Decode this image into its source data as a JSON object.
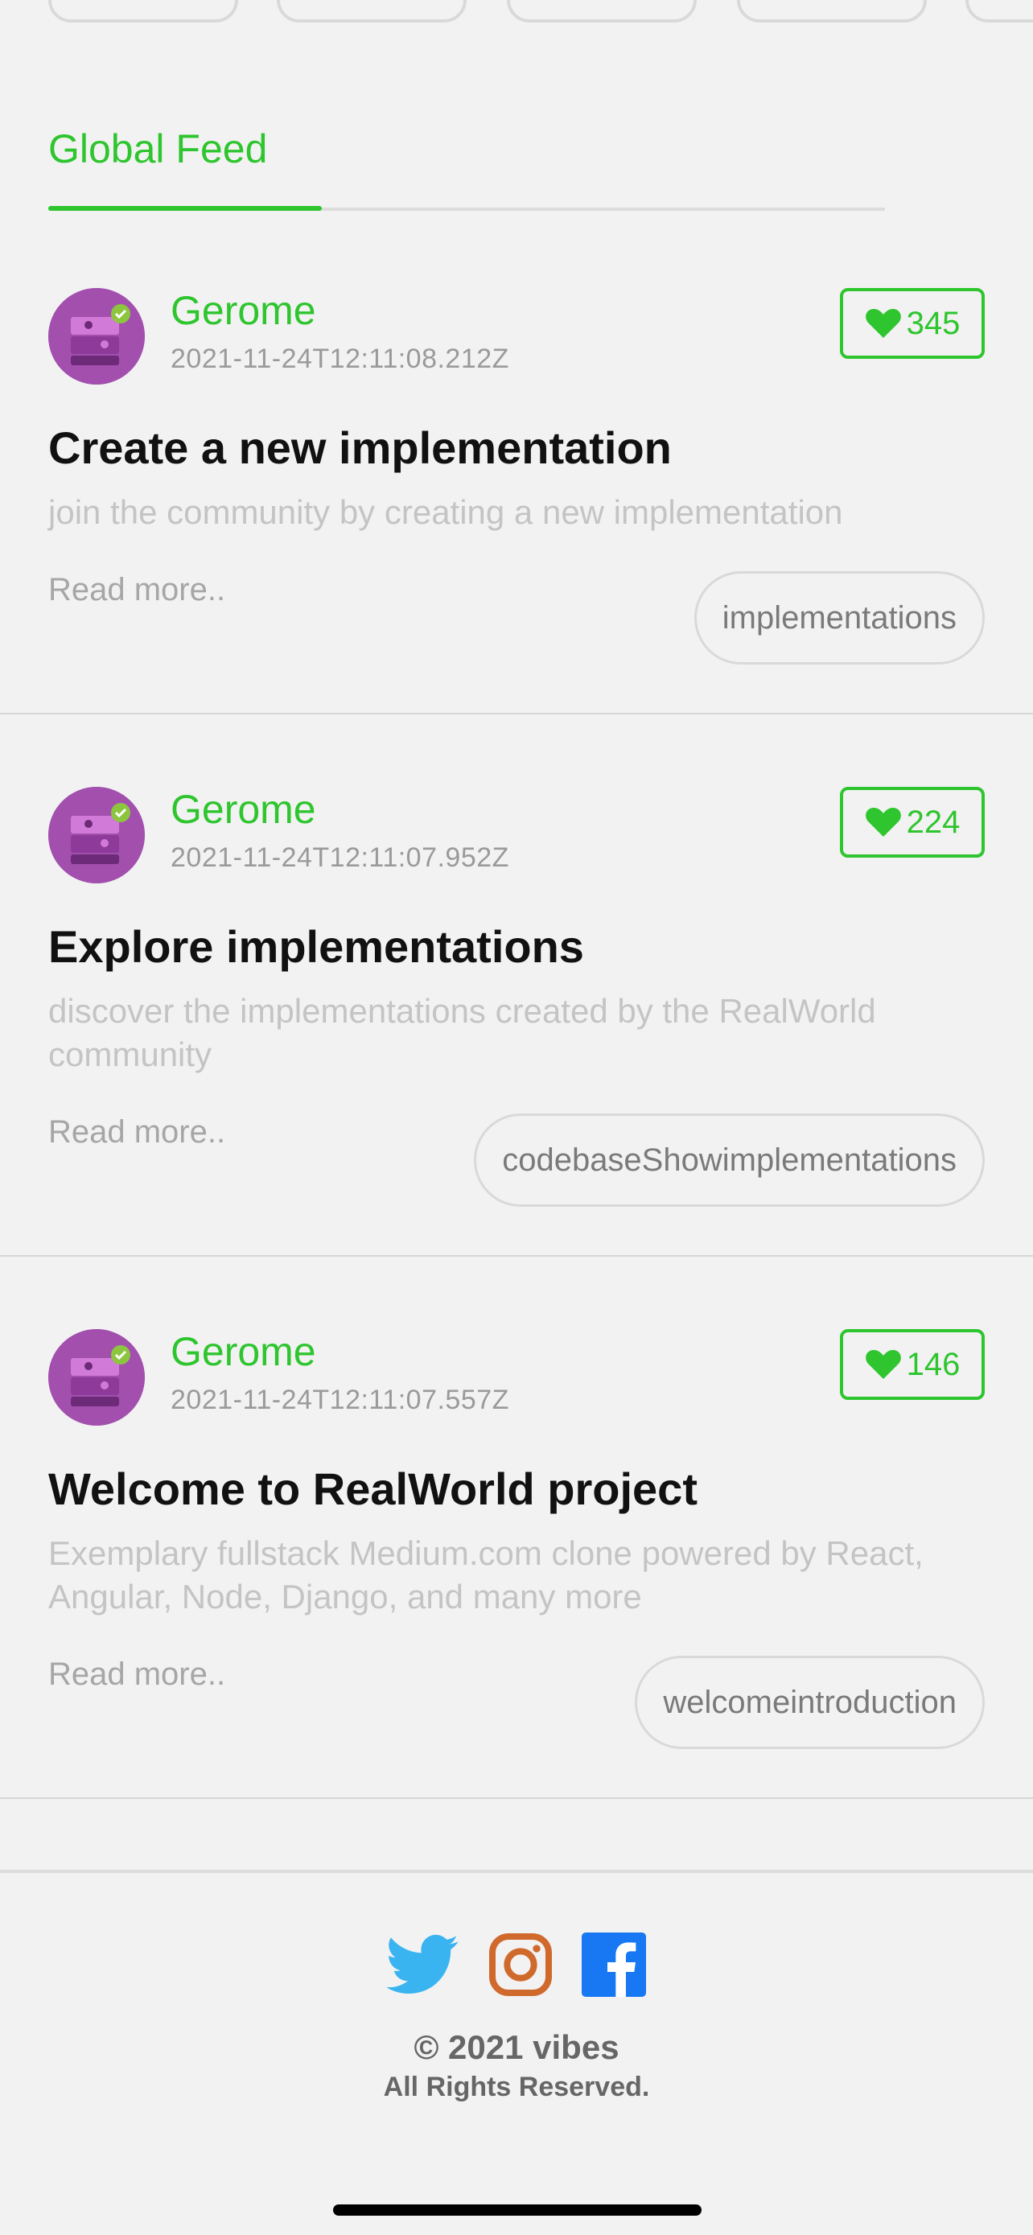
{
  "feed": {
    "tab_label": "Global Feed"
  },
  "articles": [
    {
      "author": "Gerome",
      "date": "2021-11-24T12:11:08.212Z",
      "likes": "345",
      "title": "Create a new implementation",
      "description": "join the community by creating a new implementation",
      "read_more": "Read more..",
      "tag": "implementations"
    },
    {
      "author": "Gerome",
      "date": "2021-11-24T12:11:07.952Z",
      "likes": "224",
      "title": "Explore implementations",
      "description": "discover the implementations created by the RealWorld community",
      "read_more": "Read more..",
      "tag": "codebaseShowimplementations"
    },
    {
      "author": "Gerome",
      "date": "2021-11-24T12:11:07.557Z",
      "likes": "146",
      "title": "Welcome to RealWorld project",
      "description": "Exemplary fullstack Medium.com clone powered by React, Angular, Node, Django, and many more",
      "read_more": "Read more..",
      "tag": "welcomeintroduction"
    }
  ],
  "footer": {
    "icons": [
      "twitter-icon",
      "instagram-icon",
      "facebook-icon"
    ],
    "copyright": "© 2021 vibes",
    "rights": "All Rights Reserved."
  },
  "colors": {
    "accent": "#2ec52e",
    "background": "#f2f2f2",
    "avatar": "#a24fae",
    "twitter": "#3ab4f0",
    "instagram": "#d06a2c",
    "facebook": "#1877f2"
  }
}
